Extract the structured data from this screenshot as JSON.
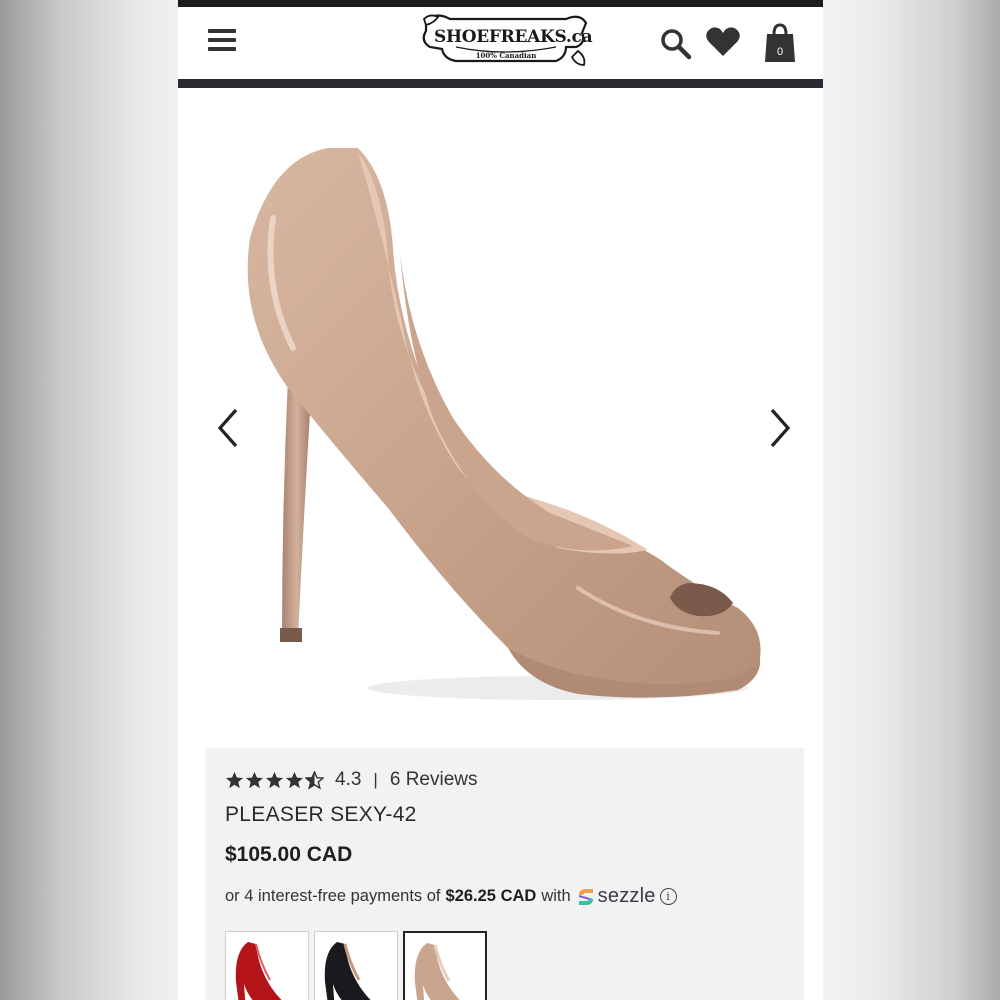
{
  "header": {
    "menu_icon": "hamburger-menu-icon",
    "logo_text": "SHOEFREAKS.ca",
    "logo_subtitle": "100% Canadian",
    "search_icon": "search-icon",
    "wishlist_icon": "heart-icon",
    "cart_icon": "shopping-bag-icon",
    "cart_count": "0"
  },
  "gallery": {
    "prev_icon": "chevron-left-icon",
    "next_icon": "chevron-right-icon"
  },
  "product": {
    "rating": {
      "stars": 4.5,
      "value": "4.3",
      "separator": "|",
      "reviews_label": "6 Reviews"
    },
    "title": "PLEASER SEXY-42",
    "price": "$105.00 CAD",
    "installments": {
      "prefix": "or 4 interest-free payments of",
      "amount": "$26.25 CAD",
      "suffix": "with",
      "provider": "sezzle",
      "info_symbol": "i"
    },
    "swatches": [
      {
        "color_name": "red",
        "color": "#b2141a",
        "selected": false
      },
      {
        "color_name": "black",
        "color": "#1a1a1e",
        "selected": false
      },
      {
        "color_name": "nude",
        "color": "#c9a58d",
        "selected": true
      }
    ]
  },
  "colors": {
    "header_rule": "#2a2a30",
    "info_panel_bg": "#f2f2f2",
    "shoe_nude": "#c9a58d"
  }
}
